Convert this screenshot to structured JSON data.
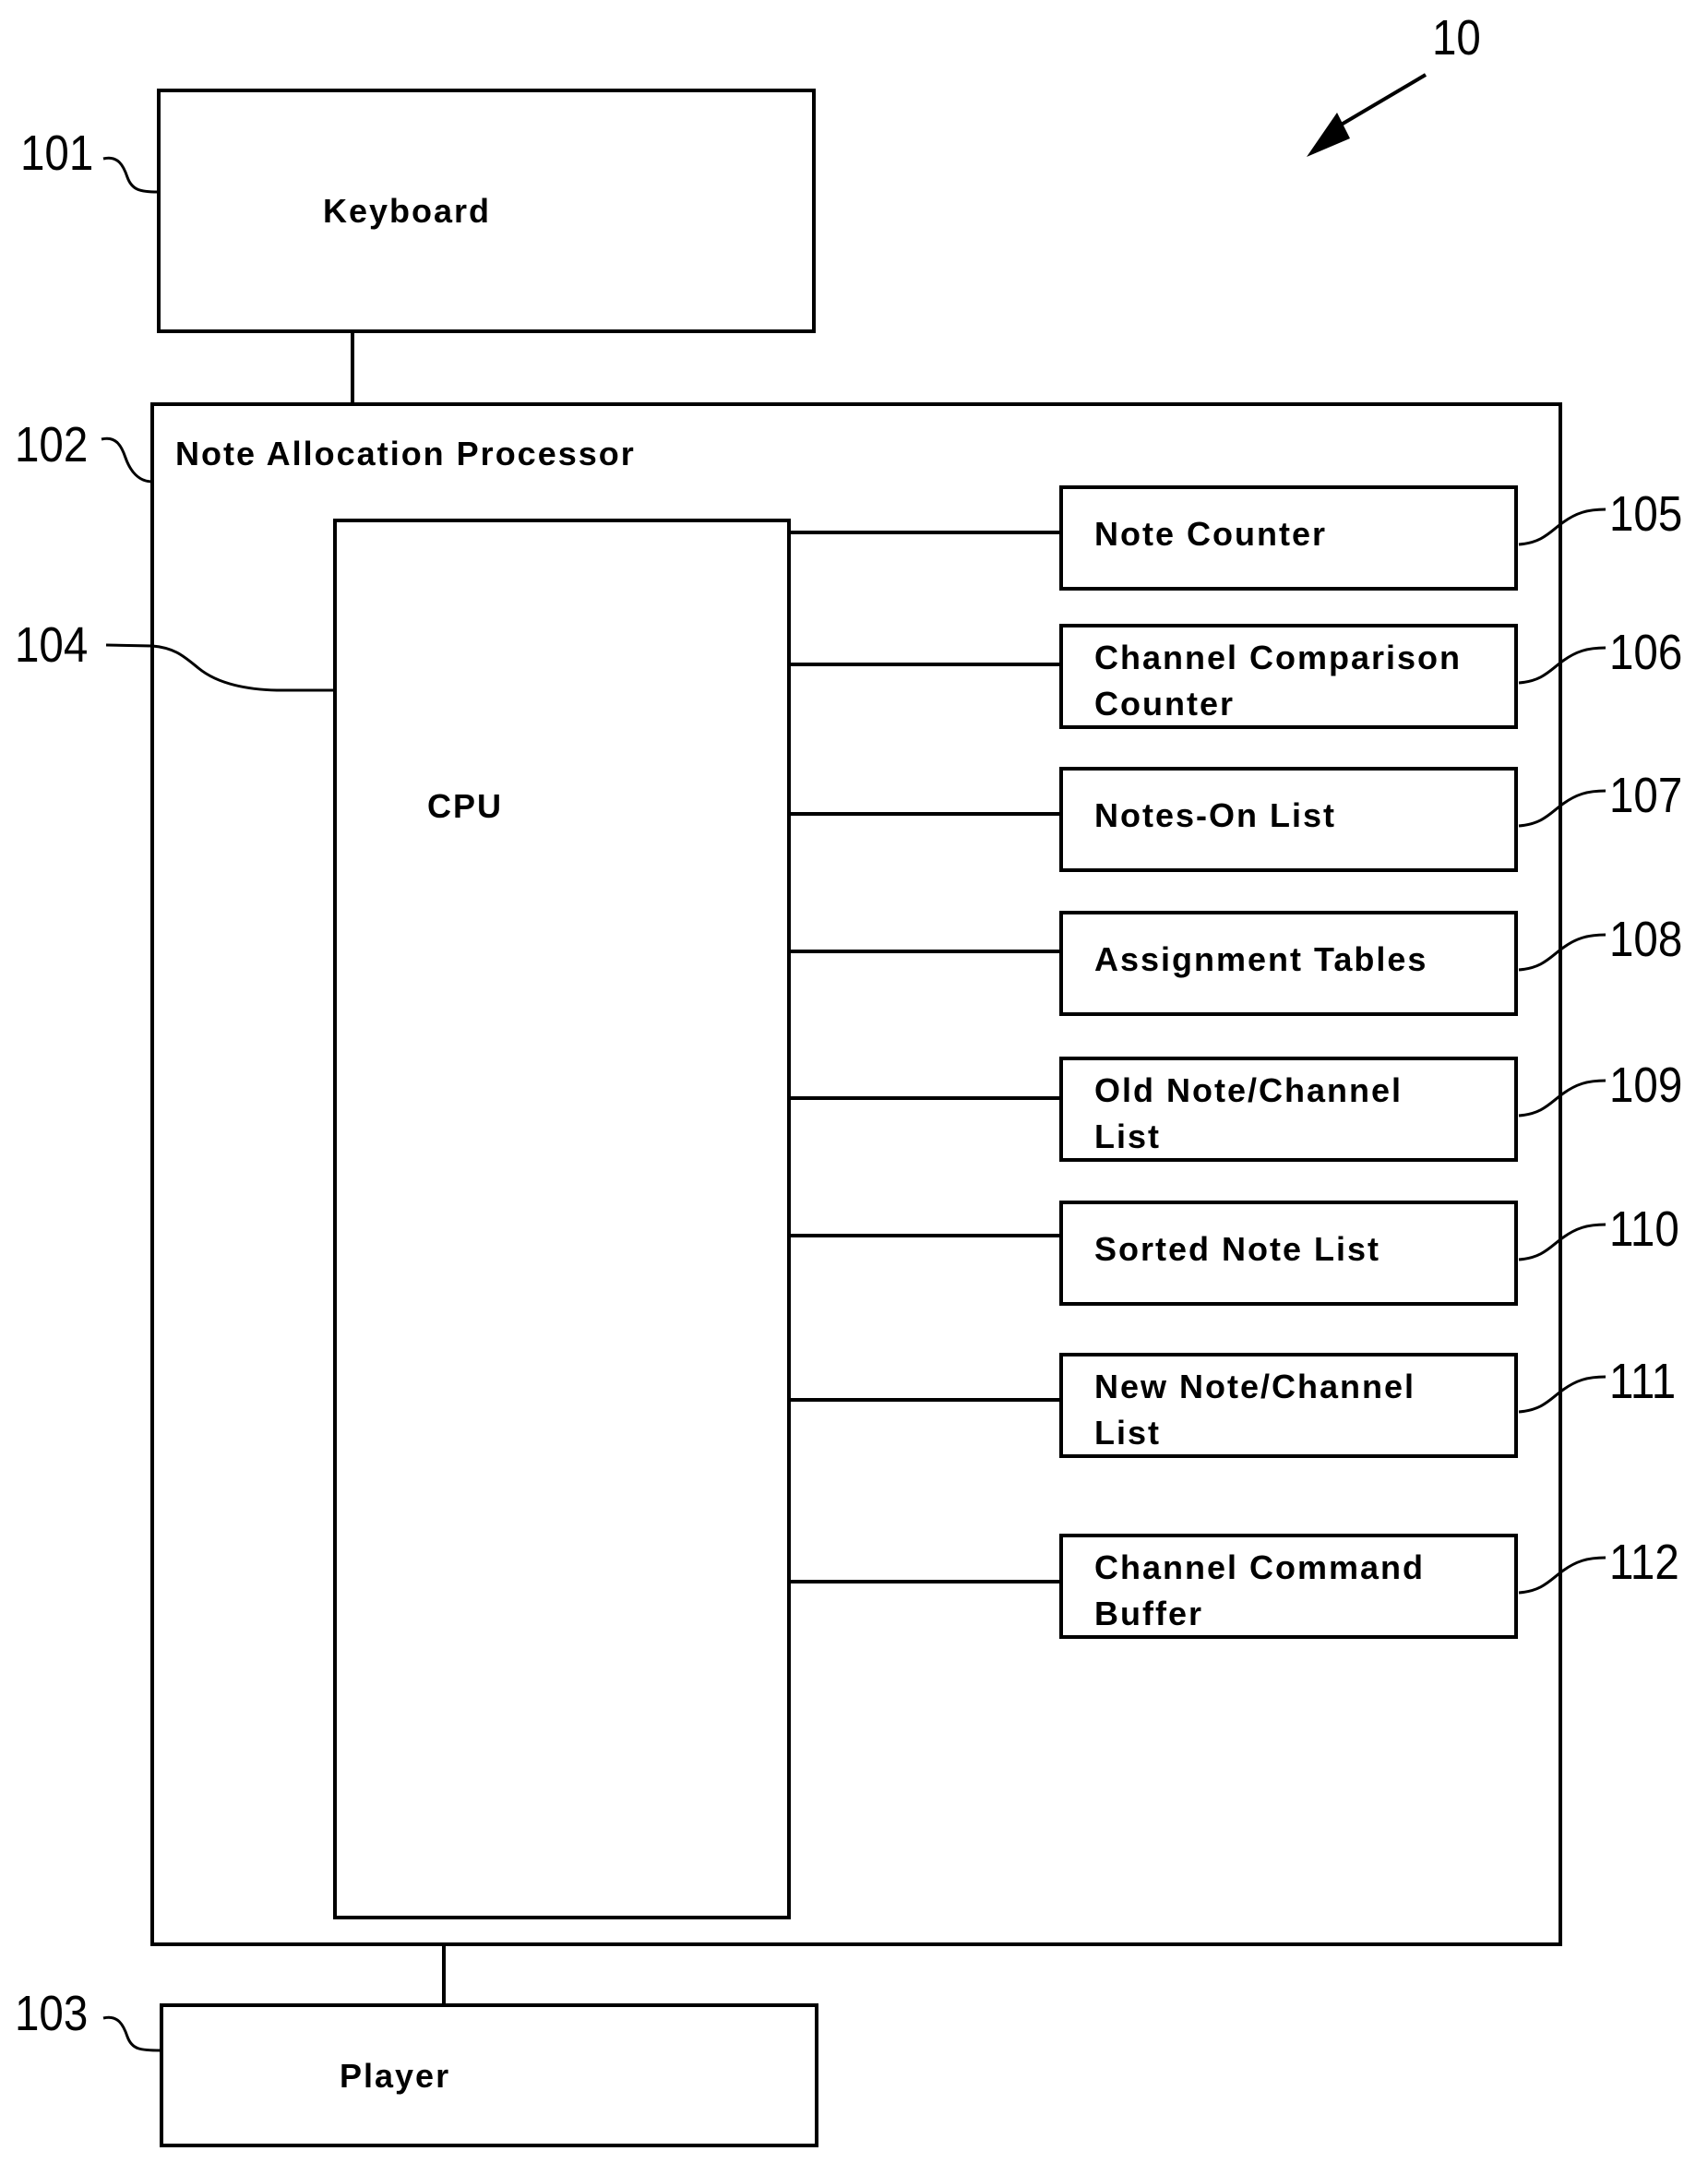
{
  "figure": {
    "ref": "10"
  },
  "keyboard": {
    "label": "Keyboard",
    "ref": "101"
  },
  "processor": {
    "label": "Note Allocation Processor",
    "ref": "102"
  },
  "player": {
    "label": "Player",
    "ref": "103"
  },
  "cpu": {
    "label": "CPU",
    "ref": "104"
  },
  "components": [
    {
      "ref": "105",
      "lines": [
        "Note Counter"
      ]
    },
    {
      "ref": "106",
      "lines": [
        "Channel Comparison",
        "Counter"
      ]
    },
    {
      "ref": "107",
      "lines": [
        "Notes-On List"
      ]
    },
    {
      "ref": "108",
      "lines": [
        "Assignment Tables"
      ]
    },
    {
      "ref": "109",
      "lines": [
        "Old Note/Channel",
        "List"
      ]
    },
    {
      "ref": "110",
      "lines": [
        "Sorted Note List"
      ]
    },
    {
      "ref": "111",
      "lines": [
        "New Note/Channel",
        "List"
      ]
    },
    {
      "ref": "112",
      "lines": [
        "Channel Command",
        "Buffer"
      ]
    }
  ]
}
